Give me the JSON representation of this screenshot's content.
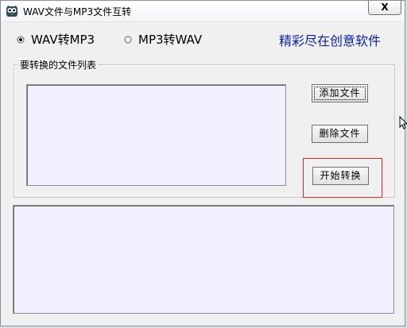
{
  "window": {
    "title": "WAV文件与MP3文件互转",
    "close_label": "X"
  },
  "mode": {
    "options": [
      {
        "label": "WAV转MP3",
        "selected": true
      },
      {
        "label": "MP3转WAV",
        "selected": false
      }
    ]
  },
  "slogan": "精彩尽在创意软件",
  "file_group": {
    "legend": "要转换的文件列表"
  },
  "buttons": {
    "add": "添加文件",
    "delete": "删除文件",
    "start": "开始转换"
  },
  "colors": {
    "slogan": "#0a1fb0",
    "highlight": "#e8262a",
    "list_bg": "#f2f0ff"
  },
  "icons": {
    "app": "owl-app-icon",
    "cursor": "mouse-pointer-icon"
  }
}
